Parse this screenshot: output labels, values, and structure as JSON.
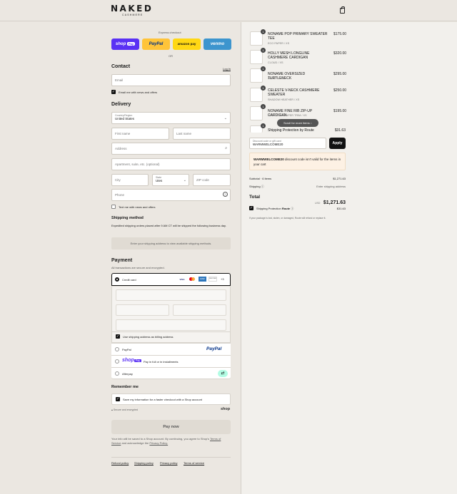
{
  "header": {
    "brand": "NAKED",
    "brand_sub": "CASHMERE"
  },
  "express": {
    "label": "Express checkout",
    "or": "OR",
    "buttons": [
      {
        "name": "shop",
        "label": "shop",
        "badge": "Pay",
        "color": "#5a31f4"
      },
      {
        "name": "paypal",
        "label": "PayPal",
        "color": "#ffc439"
      },
      {
        "name": "amazon",
        "label": "amazon pay",
        "color": "#ffd814"
      },
      {
        "name": "venmo",
        "label": "venmo",
        "color": "#3d95ce"
      }
    ]
  },
  "contact": {
    "title": "Contact",
    "login": "Log in",
    "email_placeholder": "Email",
    "news_label": "Email me with news and offers"
  },
  "delivery": {
    "title": "Delivery",
    "country_label": "Country/Region",
    "country_value": "United States",
    "first_name": "First name",
    "last_name": "Last name",
    "address": "Address",
    "apartment": "Apartment, suite, etc. (optional)",
    "city": "City",
    "state_label": "State",
    "state_value": "Utes",
    "zip": "ZIP code",
    "phone": "Phone",
    "text_label": "Text me with news and offers"
  },
  "shipping_method": {
    "title": "Shipping method",
    "note": "Expedited shipping orders placed after 9 AM CT will be shipped the following business day.",
    "placeholder": "Enter your shipping address to view available shipping methods."
  },
  "payment": {
    "title": "Payment",
    "subtitle": "All transactions are secure and encrypted.",
    "credit_card": "Credit card",
    "cards": [
      "VISA",
      "MC",
      "AMEX",
      "DISCOVER",
      "+3"
    ],
    "billing_label": "Use shipping address as billing address",
    "paypal": "PayPal",
    "paypal_logo": "PayPal",
    "shoppay_logo": "shop",
    "shoppay_badge": "Pay",
    "shoppay_text": "Pay in full or in installments",
    "afterpay": "Afterpay"
  },
  "remember": {
    "title": "Remember me",
    "label": "Save my information for a faster checkout with a Shop account",
    "secure": "Secure and encrypted",
    "shop": "shop"
  },
  "pay_now": "Pay now",
  "legal": {
    "before": "Your info will be saved to a Shop account. By continuing, you agree to Shop's",
    "terms": "Terms of Service",
    "and": "and acknowledge the",
    "privacy": "Privacy Policy."
  },
  "footer_links": [
    "Refund policy",
    "Shipping policy",
    "Privacy policy",
    "Terms of service"
  ],
  "cart": {
    "items": [
      {
        "qty": "1",
        "name": "NONAME POP PRIMARY SWEATER TEE",
        "variant": "ECO PAPER / XS",
        "price": "$175.00"
      },
      {
        "qty": "1",
        "name": "HOLLY MESH LONGLINE CASHMERE CARDIGAN",
        "variant": "CLOUD / XS",
        "price": "$320.00"
      },
      {
        "qty": "1",
        "name": "NONAME OVERSIZED TURTLENECK",
        "variant": "HUSKY / XS",
        "price": "$295.00"
      },
      {
        "qty": "1",
        "name": "CELESTE V-NECK CASHMERE SWEATER",
        "variant": "SHADOW HEATHER / XS",
        "price": "$250.00"
      },
      {
        "qty": "1",
        "name": "NONAME FINE RIB ZIP-UP CARDIGAN",
        "variant": "HUSKY/ECO PAPER TRIM / XS",
        "price": "$195.00"
      },
      {
        "qty": "1",
        "name": "Shipping Protection by Route",
        "variant": "",
        "price": "$31.63"
      }
    ],
    "scroll_hint": "Scroll for more items",
    "discount_label": "Discount code or gift card",
    "discount_value": "WARMWELCOME20",
    "apply": "Apply",
    "warning_code": "WARMWELCOME20",
    "warning_text": "discount code isn't valid for the items in your cart",
    "subtotal_label": "Subtotal · 6 items",
    "subtotal_value": "$1,271.63",
    "shipping_label": "Shipping",
    "shipping_value": "Enter shipping address",
    "total_label": "Total",
    "currency": "USD",
    "total_value": "$1,271.63",
    "protection_label": "Shipping Protection",
    "route": "Route",
    "protection_value": "$31.63",
    "protection_note": "If your package is lost, stolen, or damaged, Route will refund or replace it."
  }
}
